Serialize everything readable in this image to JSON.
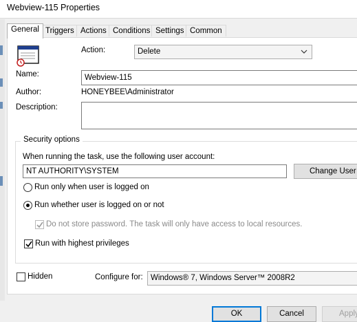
{
  "window": {
    "title": "Webview-115 Properties"
  },
  "tabs": [
    {
      "label": "General",
      "active": true
    },
    {
      "label": "Triggers",
      "active": false
    },
    {
      "label": "Actions",
      "active": false
    },
    {
      "label": "Conditions",
      "active": false
    },
    {
      "label": "Settings",
      "active": false
    },
    {
      "label": "Common",
      "active": false
    }
  ],
  "general": {
    "action_label": "Action:",
    "action_value": "Delete",
    "name_label": "Name:",
    "name_value": "Webview-115",
    "author_label": "Author:",
    "author_value": "HONEYBEE\\Administrator",
    "description_label": "Description:",
    "description_value": ""
  },
  "security": {
    "group_title": "Security options",
    "account_prompt": "When running the task, use the following user account:",
    "account_value": "NT AUTHORITY\\SYSTEM",
    "change_user_label": "Change User or",
    "radio_logged_on": "Run only when user is logged on",
    "radio_whether": "Run whether user is logged on or not",
    "selected_radio": "radio_whether",
    "no_store_password": "Do not store password. The task will only have access to local resources.",
    "no_store_password_checked": true,
    "no_store_password_enabled": false,
    "highest_privileges": "Run with highest privileges",
    "highest_privileges_checked": true
  },
  "footer": {
    "hidden_label": "Hidden",
    "hidden_checked": false,
    "configure_label": "Configure for:",
    "configure_value": "Windows® 7, Windows Server™ 2008R2"
  },
  "buttons": {
    "ok": "OK",
    "cancel": "Cancel",
    "apply": "Apply"
  },
  "icons": {
    "task": "task-window-icon",
    "dropdown": "chevron-down-icon"
  }
}
